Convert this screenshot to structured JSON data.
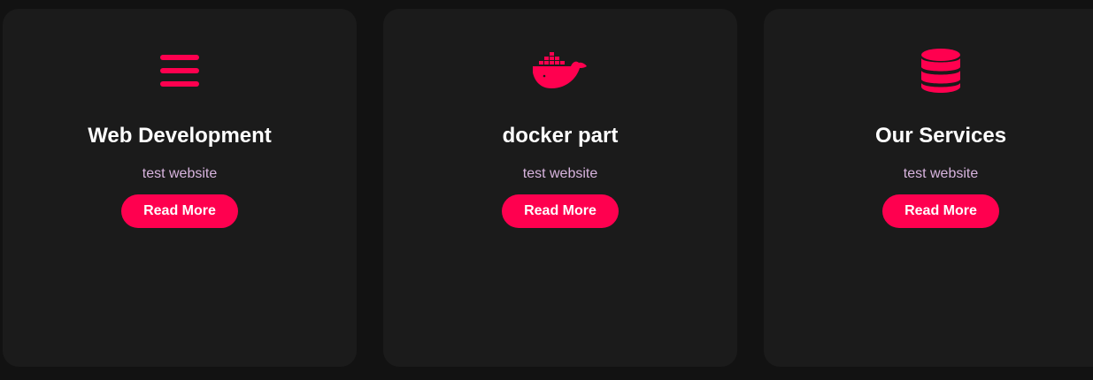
{
  "accent_color": "#ff004f",
  "cards": [
    {
      "icon": "bars-icon",
      "title": "Web Development",
      "description": "test website",
      "button_label": "Read More"
    },
    {
      "icon": "docker-icon",
      "title": "docker part",
      "description": "test website",
      "button_label": "Read More"
    },
    {
      "icon": "database-icon",
      "title": "Our Services",
      "description": "test website",
      "button_label": "Read More"
    }
  ]
}
